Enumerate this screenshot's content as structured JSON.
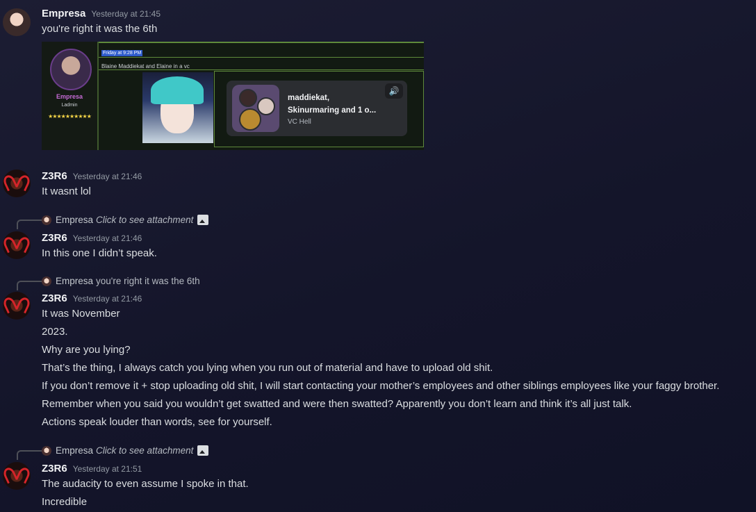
{
  "messages": [
    {
      "author": "Empresa",
      "timestamp": "Yesterday at 21:45",
      "lines": [
        "you're right it was the 6th"
      ],
      "embed": {
        "time_chip": "Friday at 9:28 PM",
        "caption": "Blaine Maddiekat and Elaine in a vc",
        "profile_name": "Empresa",
        "profile_role": "Ladmin",
        "profile_stars": "★★★★★★★★★★",
        "vc_title_line1": "maddiekat,",
        "vc_title_line2": "Skinurmaring and 1 o...",
        "vc_channel": "VC Hell",
        "vc_speaker_glyph": "🔊"
      }
    },
    {
      "author": "Z3R6",
      "timestamp": "Yesterday at 21:46",
      "lines": [
        "It wasnt lol"
      ]
    },
    {
      "reply": {
        "author": "Empresa",
        "text": "Click to see attachment",
        "italic": true,
        "has_image_icon": true
      },
      "author": "Z3R6",
      "timestamp": "Yesterday at 21:46",
      "lines": [
        "In this one I didn’t speak."
      ]
    },
    {
      "reply": {
        "author": "Empresa",
        "text": "you're right it was the 6th",
        "italic": false,
        "has_image_icon": false
      },
      "author": "Z3R6",
      "timestamp": "Yesterday at 21:46",
      "lines": [
        "It was November",
        "2023.",
        "Why are you lying?",
        "That’s the thing, I always catch you lying when you run out of material and have to upload old shit.",
        "If you don’t remove it + stop uploading old shit, I will start contacting your mother’s employees and other siblings employees like your faggy brother.",
        "Remember when you said you wouldn’t get swatted and were then swatted? Apparently you don’t learn and think it’s all just talk.",
        "Actions speak louder than words, see for yourself."
      ]
    },
    {
      "reply": {
        "author": "Empresa",
        "text": "Click to see attachment",
        "italic": true,
        "has_image_icon": true
      },
      "author": "Z3R6",
      "timestamp": "Yesterday at 21:51",
      "lines": [
        "The audacity to even assume I spoke in that.",
        "Incredible"
      ]
    }
  ]
}
